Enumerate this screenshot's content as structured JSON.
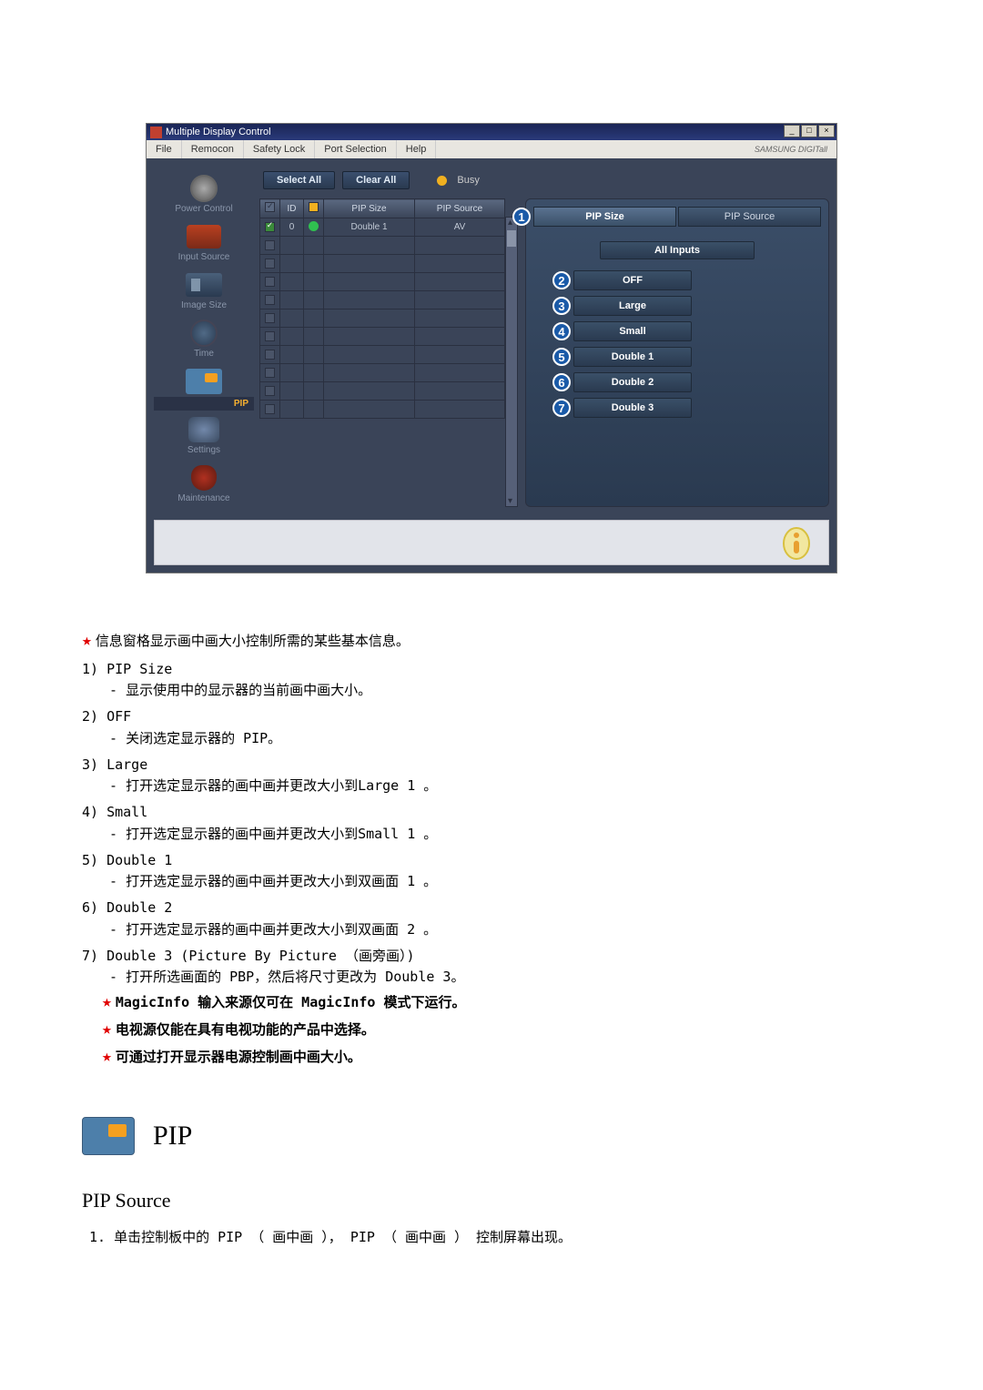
{
  "app": {
    "title": "Multiple Display Control",
    "menu": [
      "File",
      "Remocon",
      "Safety Lock",
      "Port Selection",
      "Help"
    ],
    "brand": "SAMSUNG DIGITall"
  },
  "sidebar": {
    "items": [
      {
        "label": "Power Control"
      },
      {
        "label": "Input Source"
      },
      {
        "label": "Image Size"
      },
      {
        "label": "Time"
      },
      {
        "label": "PIP"
      },
      {
        "label": "Settings"
      },
      {
        "label": "Maintenance"
      }
    ]
  },
  "top": {
    "select_all": "Select All",
    "clear_all": "Clear All",
    "busy": "Busy"
  },
  "grid": {
    "headers": {
      "id": "ID",
      "pip_size": "PIP Size",
      "pip_source": "PIP Source"
    },
    "row": {
      "id": "0",
      "pip_size": "Double 1",
      "pip_source": "AV"
    }
  },
  "panel": {
    "tabs": {
      "pip_size": "PIP Size",
      "pip_source": "PIP Source"
    },
    "sub": "All Inputs",
    "options": [
      "OFF",
      "Large",
      "Small",
      "Double 1",
      "Double 2",
      "Double 3"
    ]
  },
  "doc": {
    "intro": "信息窗格显示画中画大小控制所需的某些基本信息。",
    "items": [
      {
        "t": "PIP Size",
        "d": "显示使用中的显示器的当前画中画大小。"
      },
      {
        "t": "OFF",
        "d": "关闭选定显示器的 PIP。"
      },
      {
        "t": "Large",
        "d": "打开选定显示器的画中画并更改大小到Large 1 。"
      },
      {
        "t": "Small",
        "d": "打开选定显示器的画中画并更改大小到Small 1 。"
      },
      {
        "t": "Double 1",
        "d": "打开选定显示器的画中画并更改大小到双画面 1 。"
      },
      {
        "t": "Double 2",
        "d": "打开选定显示器的画中画并更改大小到双画面 2 。"
      },
      {
        "t": "Double 3 (Picture By Picture （画旁画）)",
        "d": "打开所选画面的 PBP，然后将尺寸更改为 Double 3。"
      }
    ],
    "notes": [
      "MagicInfo 输入来源仅可在 MagicInfo 模式下运行。",
      "电视源仅能在具有电视功能的产品中选择。",
      "可通过打开显示器电源控制画中画大小。"
    ],
    "section_title": "PIP",
    "sub_heading": "PIP Source",
    "sub_list_1": "1. 单击控制板中的 PIP （ 画中画 ）， PIP （ 画中画 ） 控制屏幕出现。"
  }
}
